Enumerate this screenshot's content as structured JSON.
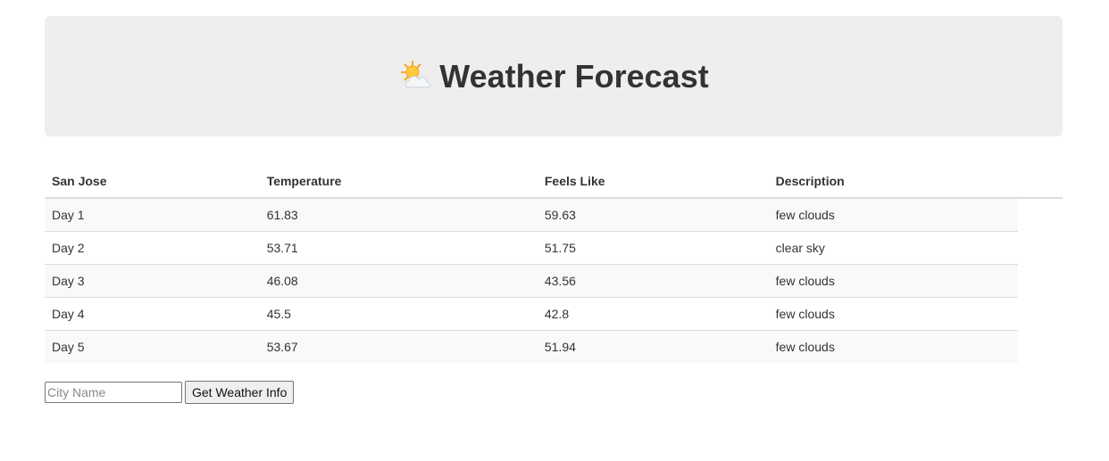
{
  "header": {
    "title": "Weather Forecast",
    "icon": "sun-behind-cloud-icon"
  },
  "table": {
    "headers": [
      "San Jose",
      "Temperature",
      "Feels Like",
      "Description"
    ],
    "rows": [
      {
        "day": "Day 1",
        "temperature": "61.83",
        "feels_like": "59.63",
        "description": "few clouds"
      },
      {
        "day": "Day 2",
        "temperature": "53.71",
        "feels_like": "51.75",
        "description": "clear sky"
      },
      {
        "day": "Day 3",
        "temperature": "46.08",
        "feels_like": "43.56",
        "description": "few clouds"
      },
      {
        "day": "Day 4",
        "temperature": "45.5",
        "feels_like": "42.8",
        "description": "few clouds"
      },
      {
        "day": "Day 5",
        "temperature": "53.67",
        "feels_like": "51.94",
        "description": "few clouds"
      }
    ]
  },
  "form": {
    "city_placeholder": "City Name",
    "city_value": "",
    "submit_label": "Get Weather Info"
  },
  "colors": {
    "jumbotron_bg": "#eeeeee",
    "stripe_bg": "#f9f9f9",
    "text": "#333333"
  }
}
